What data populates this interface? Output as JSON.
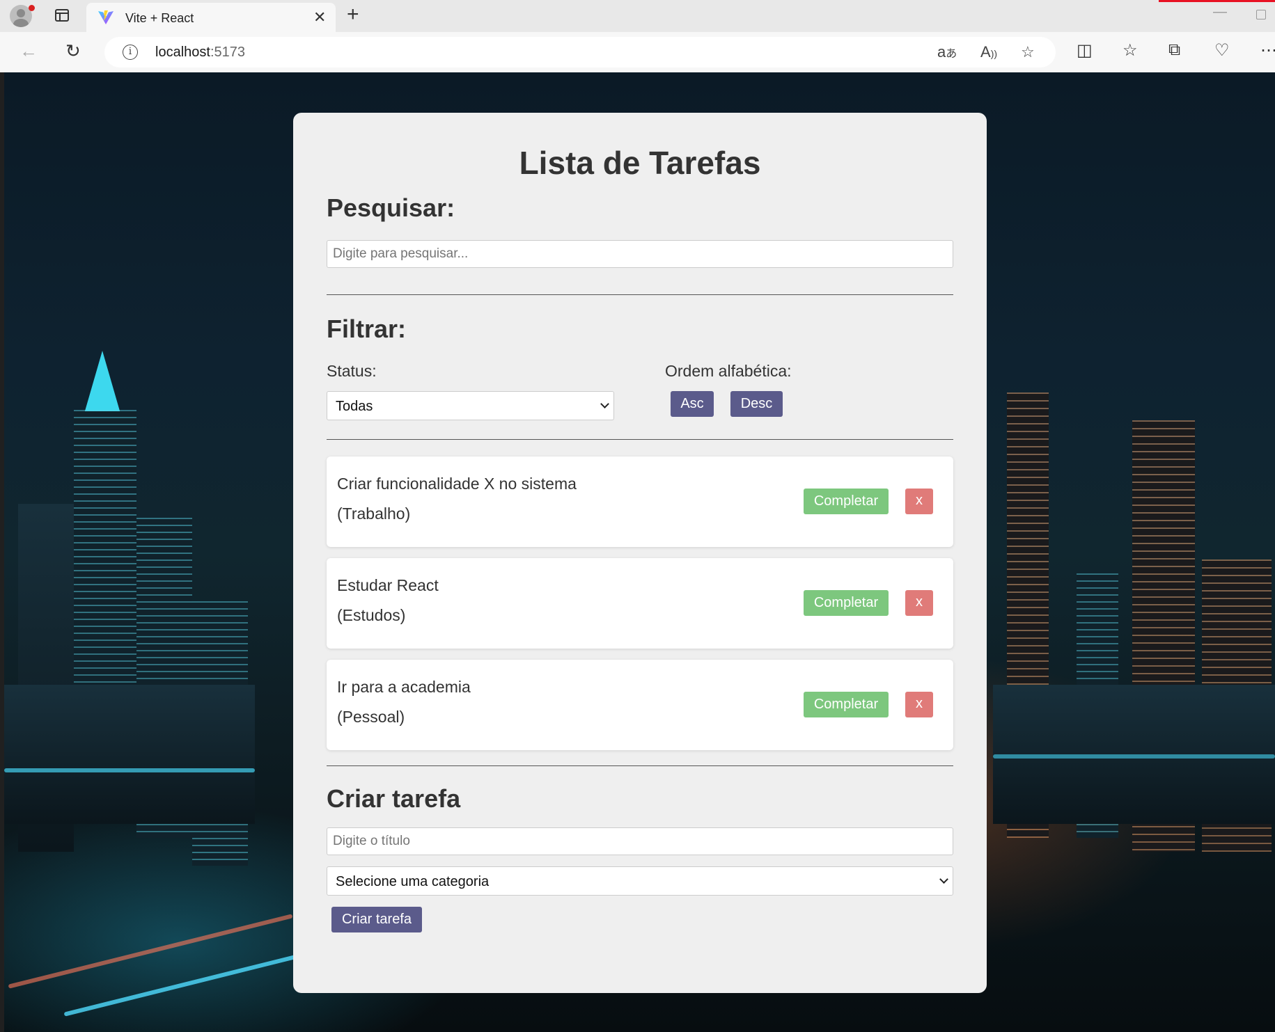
{
  "browser": {
    "tab_title": "Vite + React",
    "tab_close": "✕",
    "new_tab": "+",
    "url_host": "localhost",
    "url_port": ":5173"
  },
  "app": {
    "title": "Lista de Tarefas",
    "search": {
      "heading": "Pesquisar:",
      "placeholder": "Digite para pesquisar..."
    },
    "filter": {
      "heading": "Filtrar:",
      "status_label": "Status:",
      "status_value": "Todas",
      "order_label": "Ordem alfabética:",
      "asc_label": "Asc",
      "desc_label": "Desc"
    },
    "todos": [
      {
        "text": "Criar funcionalidade X no sistema",
        "category": "(Trabalho)",
        "complete_label": "Completar",
        "remove_label": "x"
      },
      {
        "text": "Estudar React",
        "category": "(Estudos)",
        "complete_label": "Completar",
        "remove_label": "x"
      },
      {
        "text": "Ir para a academia",
        "category": "(Pessoal)",
        "complete_label": "Completar",
        "remove_label": "x"
      }
    ],
    "create": {
      "heading": "Criar tarefa",
      "title_placeholder": "Digite o título",
      "category_value": "Selecione uma categoria",
      "submit_label": "Criar tarefa"
    }
  },
  "colors": {
    "primary_button": "#5b5b8b",
    "complete_button": "#7dc77e",
    "remove_button": "#e07b79",
    "card_background": "#efefef"
  },
  "icons": [
    "profile-icon",
    "tabs-icon",
    "vite-favicon-icon",
    "close-icon",
    "plus-icon",
    "back-icon",
    "reload-icon",
    "info-icon",
    "translate-icon",
    "read-aloud-icon",
    "favorite-star-icon",
    "split-screen-icon",
    "favorites-icon",
    "collections-icon",
    "browser-essentials-icon",
    "more-icon",
    "chevron-down-icon"
  ]
}
